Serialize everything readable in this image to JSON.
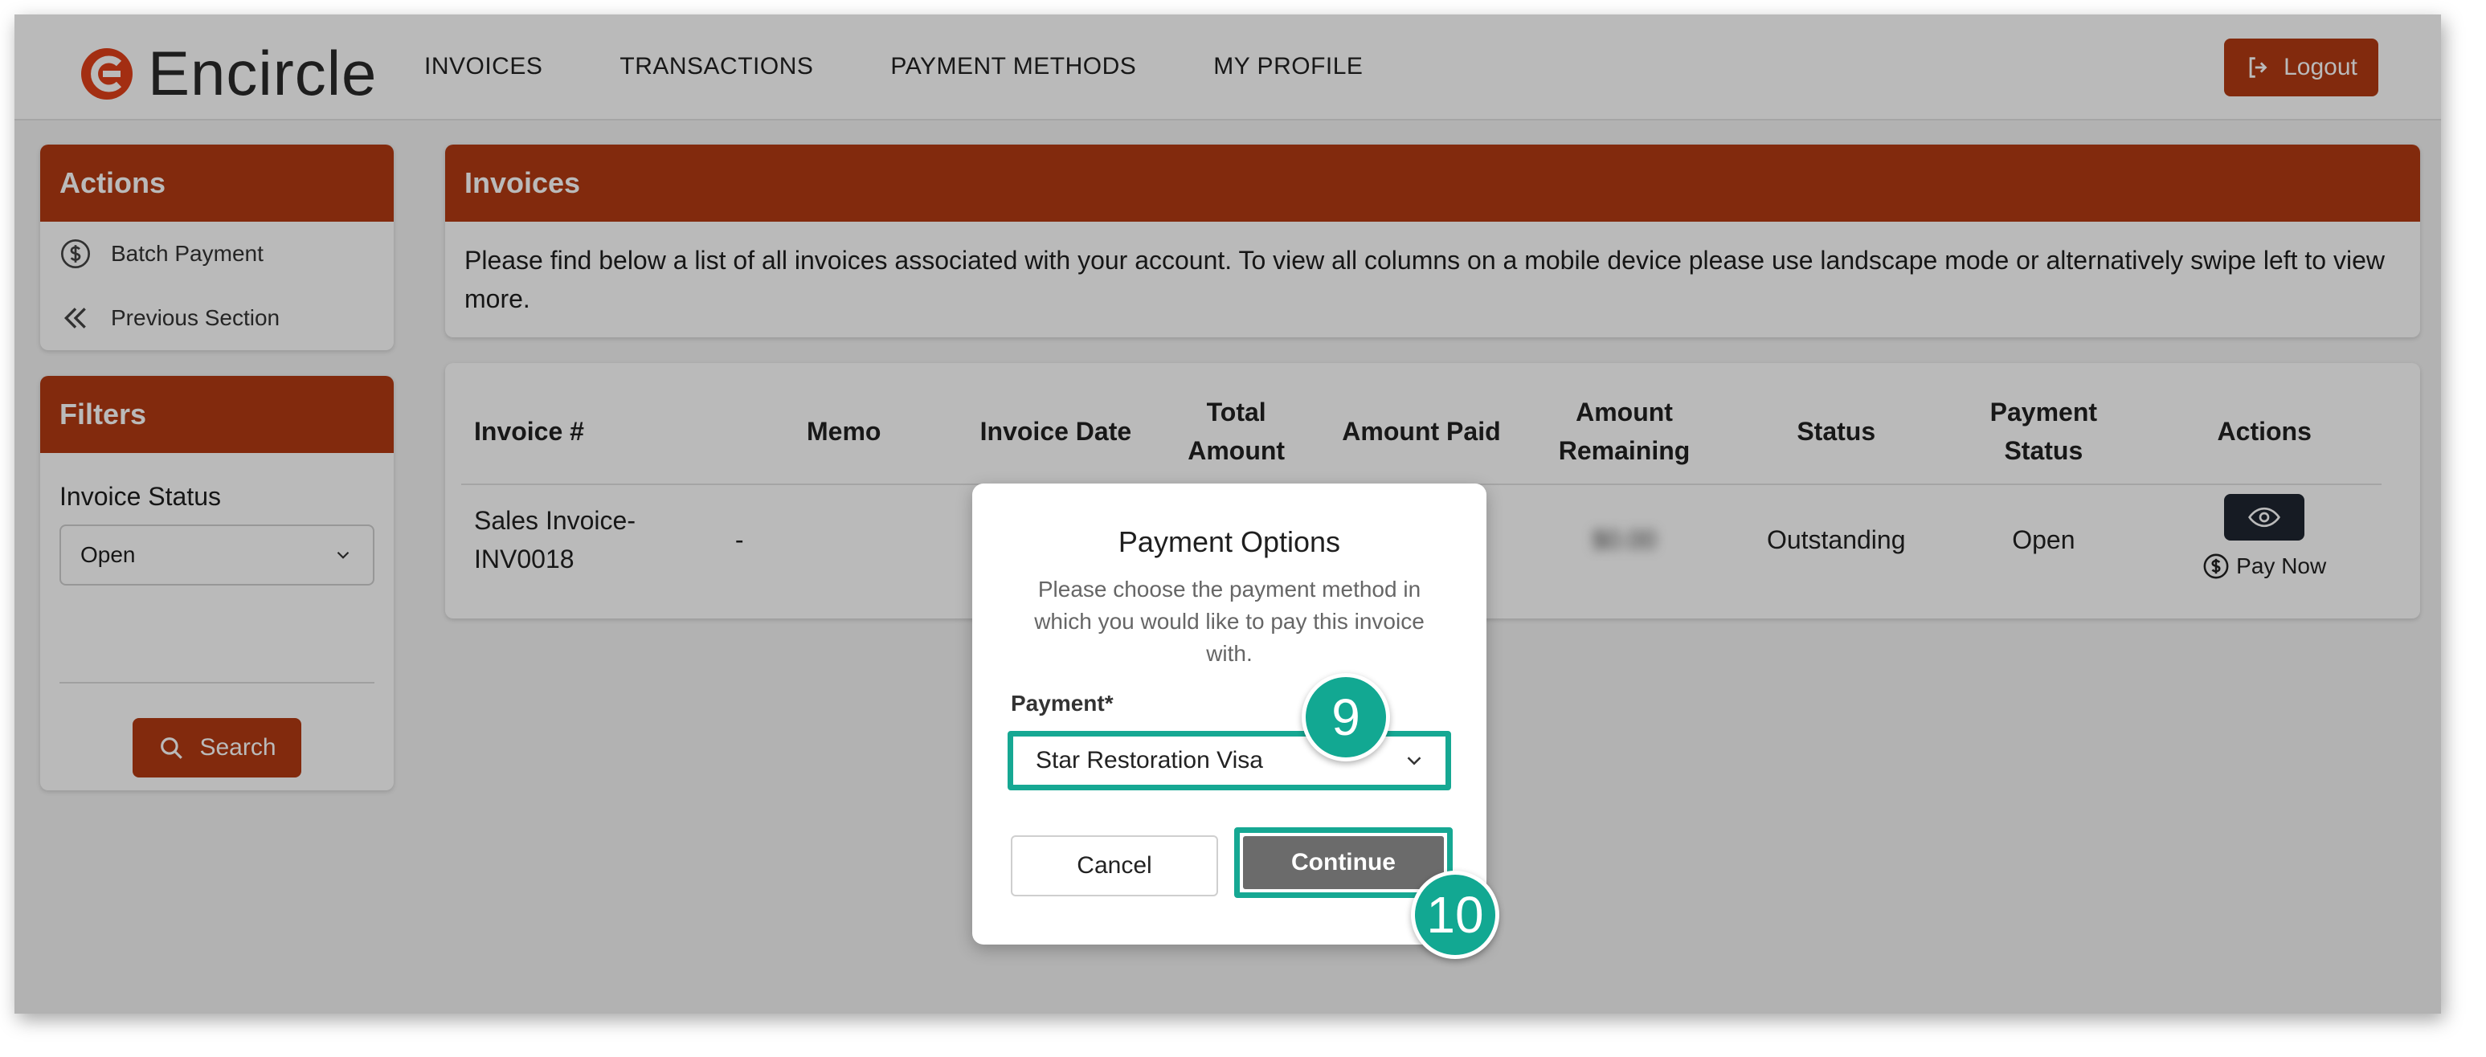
{
  "brand": {
    "name": "Encircle",
    "accent": "#b23a12",
    "callout_color": "#12a892"
  },
  "nav": {
    "items": [
      {
        "label": "INVOICES"
      },
      {
        "label": "TRANSACTIONS"
      },
      {
        "label": "PAYMENT METHODS"
      },
      {
        "label": "MY PROFILE"
      }
    ],
    "logout_label": "Logout"
  },
  "sidebar": {
    "actions_title": "Actions",
    "actions": [
      {
        "label": "Batch Payment",
        "icon": "dollar-circle-icon"
      },
      {
        "label": "Previous Section",
        "icon": "double-chevron-left-icon"
      }
    ],
    "filters_title": "Filters",
    "invoice_status_label": "Invoice Status",
    "invoice_status_value": "Open",
    "search_label": "Search"
  },
  "main": {
    "title": "Invoices",
    "description": "Please find below a list of all invoices associated with your account. To view all columns on a mobile device please use landscape mode or alternatively swipe left to view more.",
    "table": {
      "headers": [
        "Invoice #",
        "Memo",
        "Invoice Date",
        "Total Amount",
        "Amount Paid",
        "Amount Remaining",
        "Status",
        "Payment Status",
        "Actions"
      ],
      "rows": [
        {
          "invoice": "Sales Invoice-INV0018",
          "memo": "-",
          "amount_remaining": "$0.00",
          "status": "Outstanding",
          "payment_status": "Open",
          "pay_now_label": "Pay Now"
        }
      ]
    }
  },
  "modal": {
    "title": "Payment Options",
    "description": "Please choose the payment method in which you would like to pay this invoice with.",
    "payment_label": "Payment*",
    "payment_value": "Star Restoration Visa",
    "cancel_label": "Cancel",
    "continue_label": "Continue"
  },
  "callouts": [
    {
      "number": "9"
    },
    {
      "number": "10"
    }
  ]
}
